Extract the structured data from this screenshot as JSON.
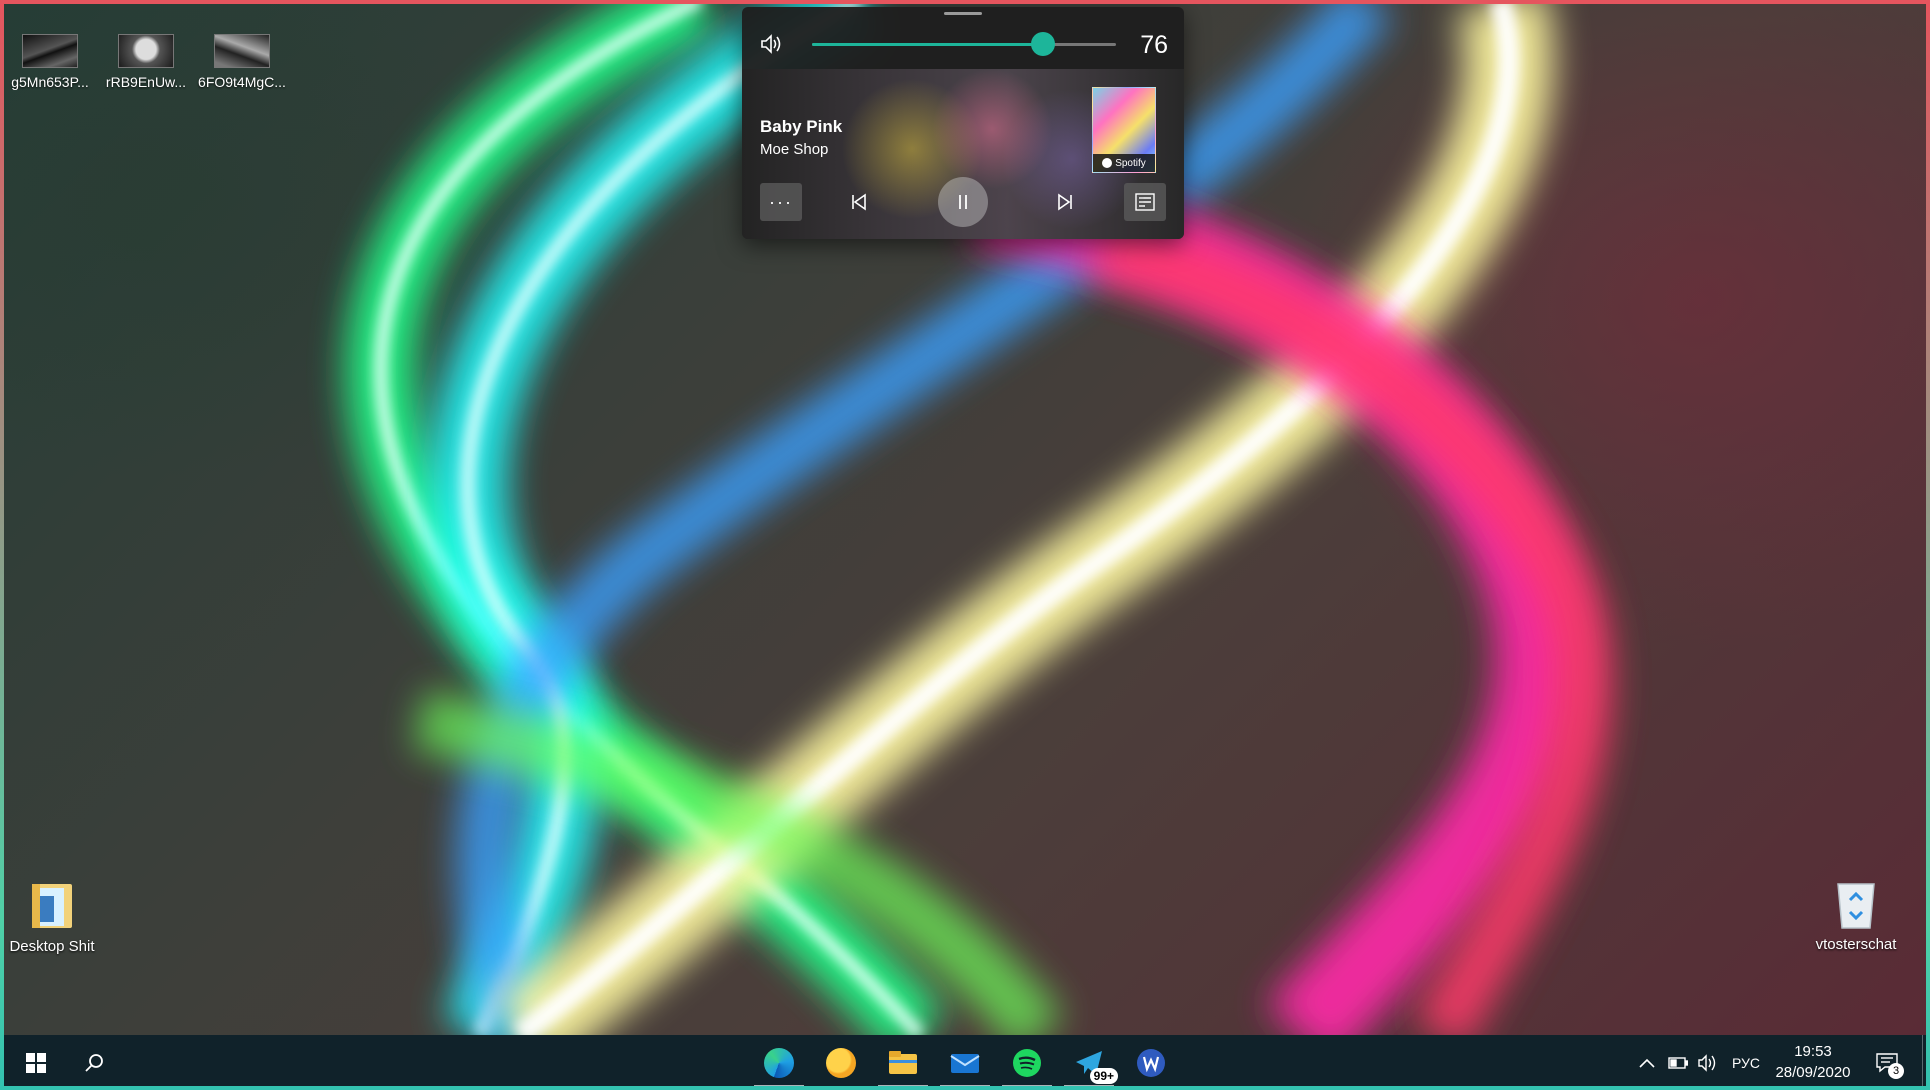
{
  "desktop": {
    "icons_top": [
      {
        "label": "g5Mn653P..."
      },
      {
        "label": "rRB9EnUw..."
      },
      {
        "label": "6FO9t4MgC..."
      }
    ],
    "folder": {
      "label": "Desktop Shit"
    },
    "recycle": {
      "label": "vtosterschat"
    }
  },
  "media": {
    "volume": 76,
    "volume_text": "76",
    "title": "Baby Pink",
    "artist": "Moe Shop",
    "source": "Spotify",
    "more_label": "···"
  },
  "taskbar": {
    "telegram_badge": "99+",
    "language": "РУС",
    "time": "19:53",
    "date": "28/09/2020",
    "notification_count": "3"
  },
  "colors": {
    "accent": "#1db59a",
    "taskbar_bg": "#10222a",
    "flyout_bg": "#1e1e1e"
  }
}
